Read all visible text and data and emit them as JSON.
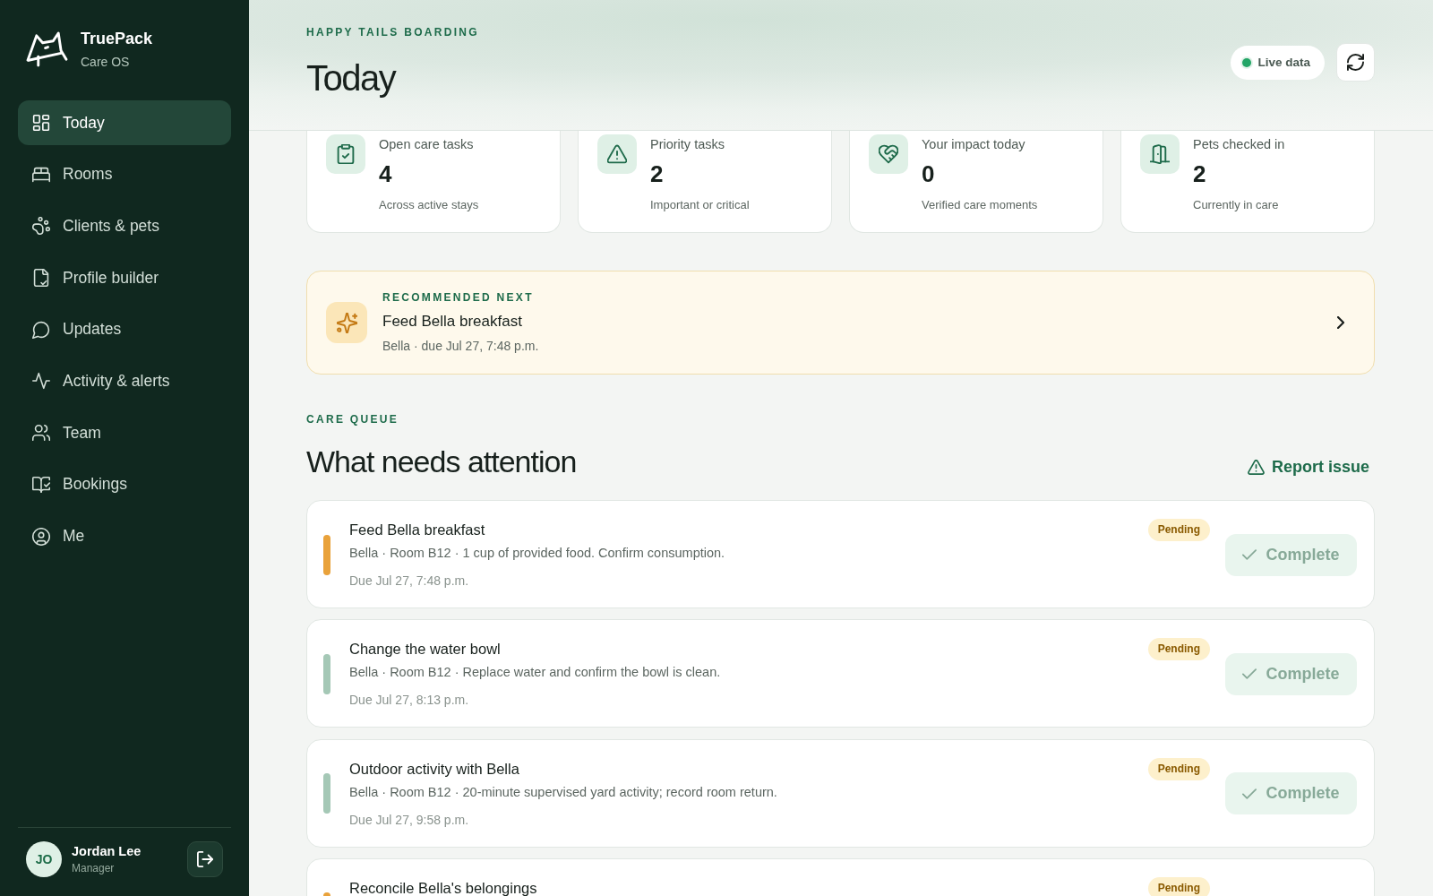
{
  "sidebar": {
    "brand": {
      "name": "TruePack",
      "subtitle": "Care OS"
    },
    "nav": [
      {
        "label": "Today",
        "selected": true
      },
      {
        "label": "Rooms",
        "selected": false
      },
      {
        "label": "Clients & pets",
        "selected": false
      },
      {
        "label": "Profile builder",
        "selected": false
      },
      {
        "label": "Updates",
        "selected": false
      },
      {
        "label": "Activity & alerts",
        "selected": false
      },
      {
        "label": "Team",
        "selected": false
      },
      {
        "label": "Bookings",
        "selected": false
      },
      {
        "label": "Me",
        "selected": false
      }
    ],
    "user": {
      "initials": "JO",
      "name": "Jordan Lee",
      "role": "Manager"
    }
  },
  "header": {
    "eyebrow": "HAPPY TAILS BOARDING",
    "title": "Today",
    "live_badge": {
      "label": "Live data",
      "on": true
    }
  },
  "stats": [
    {
      "label": "Open care tasks",
      "value": "4",
      "caption": "Across active stays"
    },
    {
      "label": "Priority tasks",
      "value": "2",
      "caption": "Important or critical"
    },
    {
      "label": "Your impact today",
      "value": "0",
      "caption": "Verified care moments"
    },
    {
      "label": "Pets checked in",
      "value": "2",
      "caption": "Currently in care"
    }
  ],
  "recommended": {
    "eyebrow": "RECOMMENDED NEXT",
    "title": "Feed Bella breakfast",
    "subtitle": "Bella · due Jul 27, 7:48 p.m."
  },
  "care_queue": {
    "eyebrow": "CARE QUEUE",
    "title": "What needs attention",
    "report_link": "Report issue",
    "tasks": [
      {
        "title": "Feed Bella breakfast",
        "details": "Bella · Room B12 · 1 cup of provided food. Confirm consumption.",
        "due": "Due Jul 27, 7:48 p.m.",
        "status": "Pending",
        "color": "#e9a23b",
        "action": {
          "label": "Complete",
          "disabled": true
        }
      },
      {
        "title": "Change the water bowl",
        "details": "Bella · Room B12 · Replace water and confirm the bowl is clean.",
        "due": "Due Jul 27, 8:13 p.m.",
        "status": "Pending",
        "color": "#a5c8b6",
        "action": {
          "label": "Complete",
          "disabled": true
        }
      },
      {
        "title": "Outdoor activity with Bella",
        "details": "Bella · Room B12 · 20-minute supervised yard activity; record room return.",
        "due": "Due Jul 27, 9:58 p.m.",
        "status": "Pending",
        "color": "#a5c8b6",
        "action": {
          "label": "Complete",
          "disabled": true
        }
      },
      {
        "title": "Reconcile Bella's belongings",
        "status": "Pending",
        "color": "#e9a23b"
      }
    ]
  }
}
